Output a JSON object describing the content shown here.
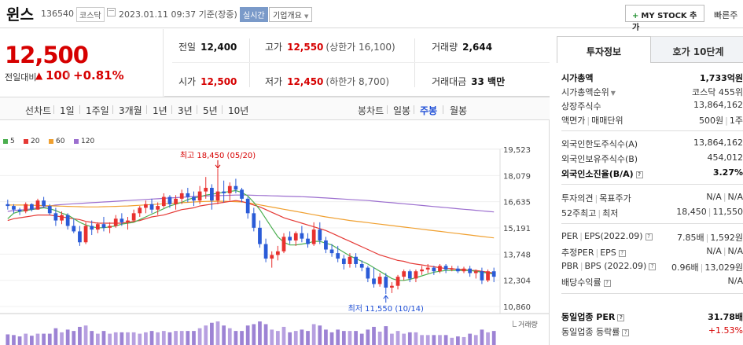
{
  "header": {
    "stock_name": "윈스",
    "stock_code": "136540",
    "market": "코스닥",
    "datetime": "2023.01.11 09:37 기준(장중)",
    "realtime": "실시간",
    "company_overview": "기업개요",
    "mystock_button": "MY STOCK 추가",
    "quick_link": "빠른주"
  },
  "price": {
    "current": "12,500",
    "change_label": "전일대비",
    "change_arrow": "▲",
    "change_value": "100",
    "change_pct": "+0.81%",
    "up_color": "#d60000"
  },
  "summary": {
    "prev_close_label": "전일",
    "prev_close": "12,400",
    "high_label": "고가",
    "high": "12,550",
    "upper_limit": "(상한가 16,100)",
    "volume_label": "거래량",
    "volume": "2,644",
    "open_label": "시가",
    "open": "12,500",
    "low_label": "저가",
    "low": "12,450",
    "lower_limit": "(하한가 8,700)",
    "amount_label": "거래대금",
    "amount": "33 백만"
  },
  "period_bar": {
    "line_label": "선차트",
    "line_items": [
      "1일",
      "1주일",
      "3개월",
      "1년",
      "3년",
      "5년",
      "10년"
    ],
    "candle_label": "봉차트",
    "candle_items": [
      "일봉",
      "주봉",
      "월봉"
    ],
    "candle_active": "주봉"
  },
  "chart_data": {
    "type": "candlestick",
    "ylim": [
      10860,
      19523
    ],
    "y_ticks": [
      "19,523",
      "18,079",
      "16,635",
      "15,191",
      "13,748",
      "12,304",
      "10,860"
    ],
    "legend": [
      {
        "name": "5",
        "color": "#4caf50"
      },
      {
        "name": "20",
        "color": "#e53935"
      },
      {
        "name": "60",
        "color": "#f0a030"
      },
      {
        "name": "120",
        "color": "#9c6fcf"
      }
    ],
    "high_annotation": "최고 18,450 (05/20)",
    "low_annotation": "최저 11,550 (10/14)",
    "volume_label": "거래량",
    "candles": [
      [
        16500,
        16750,
        16200,
        16400
      ],
      [
        16400,
        16500,
        16000,
        16200
      ],
      [
        16200,
        16300,
        15900,
        16100
      ],
      [
        16100,
        16600,
        16000,
        16500
      ],
      [
        16500,
        16550,
        16100,
        16200
      ],
      [
        16200,
        16800,
        16200,
        16700
      ],
      [
        16700,
        16900,
        16300,
        16400
      ],
      [
        16400,
        16500,
        15900,
        16000
      ],
      [
        16000,
        16300,
        15300,
        15600
      ],
      [
        15600,
        16100,
        15400,
        15900
      ],
      [
        15900,
        16000,
        15100,
        15300
      ],
      [
        15300,
        15700,
        14900,
        15000
      ],
      [
        15000,
        15300,
        14200,
        14400
      ],
      [
        14400,
        15500,
        14300,
        15300
      ],
      [
        15300,
        15600,
        14800,
        15100
      ],
      [
        15100,
        15500,
        14900,
        15400
      ],
      [
        15400,
        15800,
        15000,
        15200
      ],
      [
        15200,
        15500,
        14900,
        15300
      ],
      [
        15300,
        15900,
        15200,
        15700
      ],
      [
        15700,
        16000,
        15300,
        15500
      ],
      [
        15500,
        15800,
        15100,
        15600
      ],
      [
        15600,
        16200,
        15500,
        16000
      ],
      [
        16000,
        16400,
        15800,
        16300
      ],
      [
        16300,
        16700,
        16000,
        16500
      ],
      [
        16500,
        16800,
        16000,
        16200
      ],
      [
        16200,
        16600,
        15900,
        16400
      ],
      [
        16400,
        17100,
        16300,
        16900
      ],
      [
        16900,
        17000,
        16300,
        16500
      ],
      [
        16500,
        17000,
        16200,
        16800
      ],
      [
        16800,
        17300,
        16500,
        17100
      ],
      [
        17100,
        17400,
        16600,
        16900
      ],
      [
        16900,
        17200,
        16400,
        16700
      ],
      [
        16700,
        17500,
        16500,
        17200
      ],
      [
        17200,
        18000,
        16800,
        17400
      ],
      [
        17400,
        17600,
        16200,
        16700
      ],
      [
        16700,
        18450,
        16500,
        17200
      ],
      [
        17200,
        17800,
        16600,
        17100
      ],
      [
        17100,
        17700,
        16700,
        17500
      ],
      [
        17500,
        17900,
        17100,
        17300
      ],
      [
        17300,
        17400,
        16600,
        16800
      ],
      [
        16800,
        16900,
        15700,
        16000
      ],
      [
        16000,
        16300,
        15000,
        15200
      ],
      [
        15200,
        15600,
        14100,
        14300
      ],
      [
        14300,
        14600,
        13300,
        13500
      ],
      [
        13500,
        13900,
        13000,
        13700
      ],
      [
        13700,
        14200,
        13400,
        13900
      ],
      [
        13900,
        14900,
        13800,
        14700
      ],
      [
        14700,
        15000,
        14300,
        14500
      ],
      [
        14500,
        15000,
        14200,
        14900
      ],
      [
        14900,
        15300,
        14400,
        14600
      ],
      [
        14600,
        14900,
        14100,
        14300
      ],
      [
        14300,
        15500,
        14200,
        15100
      ],
      [
        15100,
        15500,
        14300,
        14500
      ],
      [
        14500,
        14700,
        13800,
        14000
      ],
      [
        14000,
        14300,
        13600,
        13800
      ],
      [
        13800,
        14200,
        13300,
        13500
      ],
      [
        13500,
        13700,
        12900,
        13200
      ],
      [
        13200,
        13800,
        13000,
        13600
      ],
      [
        13600,
        13800,
        13000,
        13200
      ],
      [
        13200,
        13400,
        12800,
        13000
      ],
      [
        13000,
        13100,
        12200,
        12400
      ],
      [
        12400,
        13000,
        11900,
        12100
      ],
      [
        12100,
        12700,
        11950,
        12500
      ],
      [
        12500,
        12700,
        11550,
        11900
      ],
      [
        11900,
        12200,
        11600,
        12000
      ],
      [
        12000,
        12600,
        11800,
        12500
      ],
      [
        12500,
        12900,
        12300,
        12800
      ],
      [
        12800,
        12900,
        12200,
        12400
      ],
      [
        12400,
        12900,
        12200,
        12800
      ],
      [
        12800,
        13100,
        12600,
        12900
      ],
      [
        12900,
        13200,
        12700,
        13000
      ],
      [
        13000,
        13100,
        12600,
        12800
      ],
      [
        12800,
        13200,
        12700,
        13100
      ],
      [
        13100,
        13200,
        12700,
        12900
      ],
      [
        12900,
        13100,
        12800,
        12950
      ],
      [
        12950,
        13100,
        12700,
        12800
      ],
      [
        12800,
        13050,
        12700,
        12950
      ],
      [
        12950,
        13100,
        12500,
        12700
      ],
      [
        12700,
        12900,
        12400,
        12800
      ],
      [
        12800,
        13000,
        12100,
        12300
      ],
      [
        12300,
        12900,
        12200,
        12800
      ],
      [
        12800,
        13000,
        12200,
        12500
      ]
    ],
    "ma5": [
      15700,
      16000,
      16100,
      16150,
      16200,
      16250,
      16300,
      16250,
      16150,
      16000,
      15900,
      15700,
      15500,
      15350,
      15250,
      15200,
      15200,
      15250,
      15300,
      15400,
      15450,
      15500,
      15650,
      15800,
      15950,
      16100,
      16250,
      16400,
      16500,
      16600,
      16750,
      16850,
      16900,
      17000,
      17050,
      17100,
      17150,
      17200,
      17250,
      17150,
      16950,
      16600,
      16200,
      15700,
      15200,
      14700,
      14400,
      14250,
      14250,
      14300,
      14350,
      14450,
      14450,
      14350,
      14250,
      14050,
      13850,
      13650,
      13500,
      13350,
      13200,
      13000,
      12800,
      12600,
      12400,
      12300,
      12300,
      12350,
      12450,
      12550,
      12650,
      12750,
      12800,
      12850,
      12850,
      12850,
      12850,
      12850,
      12800,
      12750,
      12700,
      12650
    ],
    "ma20": [
      15600,
      15700,
      15750,
      15800,
      15850,
      15900,
      15900,
      15900,
      15850,
      15800,
      15750,
      15700,
      15650,
      15550,
      15500,
      15450,
      15450,
      15450,
      15450,
      15450,
      15500,
      15550,
      15600,
      15700,
      15800,
      15850,
      15900,
      16000,
      16100,
      16200,
      16250,
      16300,
      16400,
      16450,
      16500,
      16550,
      16600,
      16650,
      16700,
      16650,
      16550,
      16450,
      16350,
      16200,
      16050,
      15900,
      15750,
      15650,
      15550,
      15450,
      15350,
      15250,
      15150,
      15050,
      14900,
      14750,
      14600,
      14450,
      14300,
      14150,
      14000,
      13850,
      13700,
      13600,
      13500,
      13400,
      13350,
      13250,
      13200,
      13150,
      13100,
      13050,
      13000,
      12950,
      12950,
      12900,
      12900,
      12850,
      12850,
      12800,
      12750,
      12700
    ],
    "ma60": [
      16450,
      16450,
      16450,
      16450,
      16440,
      16430,
      16420,
      16410,
      16400,
      16390,
      16380,
      16370,
      16360,
      16350,
      16350,
      16350,
      16360,
      16370,
      16380,
      16390,
      16400,
      16420,
      16440,
      16460,
      16480,
      16500,
      16520,
      16540,
      16560,
      16580,
      16600,
      16620,
      16640,
      16650,
      16660,
      16660,
      16660,
      16650,
      16640,
      16620,
      16580,
      16520,
      16460,
      16400,
      16340,
      16280,
      16220,
      16160,
      16100,
      16040,
      15980,
      15920,
      15860,
      15800,
      15750,
      15700,
      15650,
      15600,
      15560,
      15520,
      15480,
      15440,
      15400,
      15360,
      15320,
      15280,
      15240,
      15200,
      15160,
      15120,
      15080,
      15040,
      15000,
      14960,
      14920,
      14880,
      14840,
      14800,
      14760,
      14720,
      14680,
      14640
    ],
    "ma120": [
      16100,
      16150,
      16180,
      16200,
      16250,
      16300,
      16350,
      16400,
      16450,
      16480,
      16500,
      16520,
      16540,
      16560,
      16580,
      16600,
      16620,
      16640,
      16660,
      16680,
      16700,
      16720,
      16740,
      16760,
      16780,
      16800,
      16820,
      16840,
      16860,
      16880,
      16900,
      16920,
      16940,
      16950,
      16960,
      16970,
      16980,
      16990,
      17000,
      17000,
      17000,
      16990,
      16980,
      16970,
      16960,
      16950,
      16940,
      16930,
      16920,
      16910,
      16900,
      16880,
      16860,
      16840,
      16820,
      16800,
      16780,
      16760,
      16740,
      16720,
      16700,
      16670,
      16640,
      16610,
      16580,
      16550,
      16520,
      16490,
      16460,
      16430,
      16400,
      16370,
      16340,
      16310,
      16280,
      16250,
      16220,
      16190,
      16160,
      16130,
      16100,
      16070
    ]
  },
  "side": {
    "tab_active": "투자정보",
    "tab_inactive": "호가 10단계",
    "market_cap_label": "시가총액",
    "market_cap": "1,733억원",
    "market_cap_rank_label": "시가총액순위",
    "market_cap_rank": "코스닥 455위",
    "shares_label": "상장주식수",
    "shares": "13,864,162",
    "par_label": "액면가",
    "trade_unit_label": "매매단위",
    "par_value": "500원",
    "trade_unit": "1주",
    "foreign_limit_label": "외국인한도주식수(A)",
    "foreign_limit": "13,864,162",
    "foreign_hold_label": "외국인보유주식수(B)",
    "foreign_hold": "454,012",
    "foreign_ratio_label": "외국인소진율(B/A)",
    "foreign_ratio": "3.27%",
    "opinion_label": "투자의견",
    "target_label": "목표주가",
    "opinion": "N/A",
    "target": "N/A",
    "w52_high_label": "52주최고",
    "w52_low_label": "최저",
    "w52_high": "18,450",
    "w52_low": "11,550",
    "per_label": "PER",
    "eps_label": "EPS(2022.09)",
    "per": "7.85배",
    "eps": "1,592원",
    "est_per_label": "추정PER",
    "est_eps_label": "EPS",
    "est_per": "N/A",
    "est_eps": "N/A",
    "pbr_label": "PBR",
    "bps_label": "BPS (2022.09)",
    "pbr": "0.96배",
    "bps": "13,029원",
    "div_label": "배당수익률",
    "div": "N/A",
    "sector_per_label": "동일업종 PER",
    "sector_per": "31.78배",
    "sector_change_label": "동일업종 등락률",
    "sector_change": "+1.53%"
  }
}
